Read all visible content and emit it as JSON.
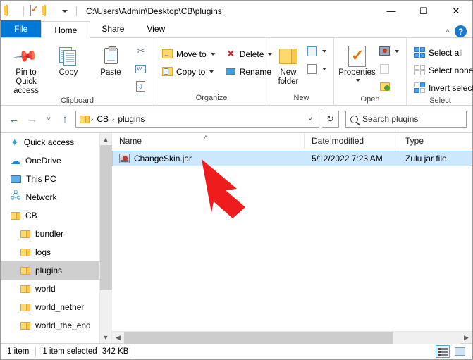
{
  "titlebar": {
    "path": "C:\\Users\\Admin\\Desktop\\CB\\plugins",
    "quick_access": [
      "folder-icon",
      "properties-icon",
      "new-folder-icon",
      "customize-dropdown"
    ],
    "minimize": "—",
    "maximize": "☐",
    "close": "✕"
  },
  "tabs": [
    {
      "label": "File",
      "active": false,
      "style": "file"
    },
    {
      "label": "Home",
      "active": true,
      "style": "normal"
    },
    {
      "label": "Share",
      "active": false,
      "style": "normal"
    },
    {
      "label": "View",
      "active": false,
      "style": "normal"
    }
  ],
  "tab_right": {
    "collapse": "˄",
    "help": "?"
  },
  "ribbon": {
    "groups": [
      {
        "label": "Clipboard",
        "big_buttons": [
          {
            "label": "Pin to Quick access",
            "icon": "pin-icon"
          },
          {
            "label": "Copy",
            "icon": "copy-icon"
          },
          {
            "label": "Paste",
            "icon": "paste-icon"
          }
        ],
        "small_buttons": [
          {
            "label": "",
            "icon": "cut-icon"
          },
          {
            "label": "",
            "icon": "copy-path-icon"
          },
          {
            "label": "",
            "icon": "paste-shortcut-icon"
          }
        ]
      },
      {
        "label": "Organize",
        "small_buttons": [
          {
            "label": "Move to",
            "icon": "move-to-icon",
            "dropdown": true
          },
          {
            "label": "Copy to",
            "icon": "copy-to-icon",
            "dropdown": true
          },
          {
            "label": "Delete",
            "icon": "delete-icon",
            "dropdown": true
          },
          {
            "label": "Rename",
            "icon": "rename-icon",
            "dropdown": false
          }
        ]
      },
      {
        "label": "New",
        "big_buttons": [
          {
            "label": "New folder",
            "icon": "new-folder-icon"
          }
        ],
        "small_buttons": [
          {
            "label": "",
            "icon": "new-item-icon",
            "dropdown": true
          },
          {
            "label": "",
            "icon": "easy-access-icon",
            "dropdown": true
          }
        ]
      },
      {
        "label": "Open",
        "big_buttons": [
          {
            "label": "Properties",
            "icon": "properties-icon",
            "dropdown": true
          }
        ],
        "small_buttons": [
          {
            "label": "",
            "icon": "open-icon",
            "dropdown": true
          },
          {
            "label": "",
            "icon": "edit-icon"
          },
          {
            "label": "",
            "icon": "history-icon"
          }
        ]
      },
      {
        "label": "Select",
        "small_buttons": [
          {
            "label": "Select all",
            "icon": "select-all-icon"
          },
          {
            "label": "Select none",
            "icon": "select-none-icon"
          },
          {
            "label": "Invert selection",
            "icon": "invert-selection-icon"
          }
        ]
      }
    ]
  },
  "addressbar": {
    "back": "←",
    "forward": "→",
    "recent": "˅",
    "up": "↑",
    "breadcrumbs": [
      "CB",
      "plugins"
    ],
    "separator": "›",
    "dropdown": "˅",
    "refresh": "↻",
    "search_placeholder": "Search plugins"
  },
  "navpane": {
    "items": [
      {
        "label": "Quick access",
        "icon": "quick-access-star-icon",
        "indent": false,
        "selected": false
      },
      {
        "label": "OneDrive",
        "icon": "onedrive-cloud-icon",
        "indent": false,
        "selected": false
      },
      {
        "label": "This PC",
        "icon": "this-pc-icon",
        "indent": false,
        "selected": false
      },
      {
        "label": "Network",
        "icon": "network-icon",
        "indent": false,
        "selected": false
      },
      {
        "label": "CB",
        "icon": "folder-icon",
        "indent": false,
        "selected": false
      },
      {
        "label": "bundler",
        "icon": "folder-icon",
        "indent": true,
        "selected": false
      },
      {
        "label": "logs",
        "icon": "folder-icon",
        "indent": true,
        "selected": false
      },
      {
        "label": "plugins",
        "icon": "folder-icon",
        "indent": true,
        "selected": true
      },
      {
        "label": "world",
        "icon": "folder-icon",
        "indent": true,
        "selected": false
      },
      {
        "label": "world_nether",
        "icon": "folder-icon",
        "indent": true,
        "selected": false
      },
      {
        "label": "world_the_end",
        "icon": "folder-icon",
        "indent": true,
        "selected": false
      }
    ]
  },
  "filelist": {
    "columns": [
      "Name",
      "Date modified",
      "Type"
    ],
    "sort_indicator": "˄",
    "rows": [
      {
        "name": "ChangeSkin.jar",
        "date_modified": "5/12/2022 7:23 AM",
        "type": "Zulu jar file",
        "icon": "jar-file-icon",
        "selected": true
      }
    ]
  },
  "statusbar": {
    "item_count": "1 item",
    "selection": "1 item selected",
    "size": "342 KB",
    "view_details": "details-view-icon",
    "view_large": "large-icons-view-icon"
  },
  "annotation": {
    "type": "red-arrow",
    "color": "#ee1c1c",
    "points_at": "ChangeSkin.jar"
  }
}
